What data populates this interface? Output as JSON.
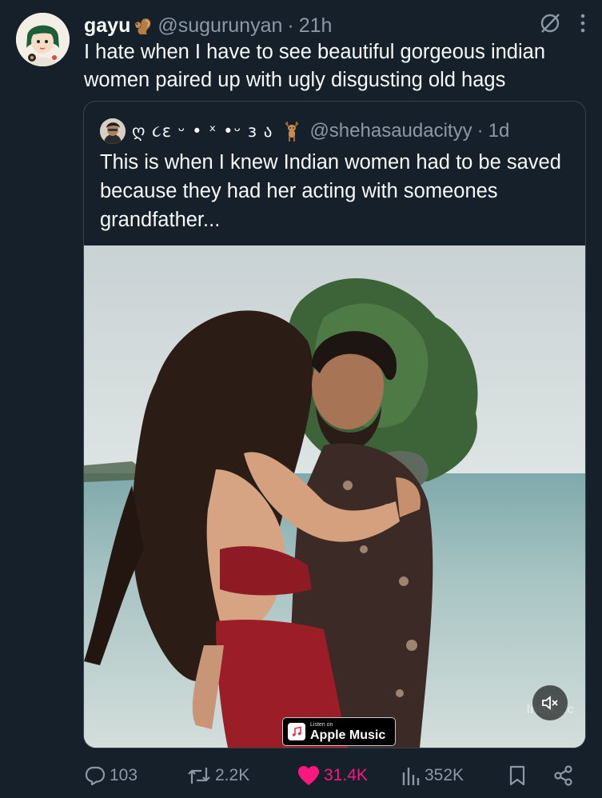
{
  "tweet": {
    "display_name": "gayu",
    "handle": "@sugurunyan",
    "separator": "·",
    "time": "21h",
    "text": "I hate when I have to see beautiful gorgeous indian women paired up with ugly disgusting old hags"
  },
  "quoted": {
    "display_name": "ღ ૮ɛ ᵕ • ˣ •ᵕ ɜ ა",
    "handle": "@shehasaudacityy",
    "separator": "·",
    "time": "1d",
    "text": "This is when I knew Indian women had to be saved because they had her acting with someones grandfather...",
    "media": {
      "badge_small": "Listen on",
      "badge_big": "Apple Music",
      "watermark": "InSh…c"
    }
  },
  "actions": {
    "replies": "103",
    "reposts": "2.2K",
    "likes": "31.4K",
    "views": "352K"
  },
  "colors": {
    "background": "#15202b",
    "text_secondary": "#8b98a5",
    "like_pink": "#f91880",
    "border": "#38444d"
  },
  "icons": [
    "grok-icon",
    "more-icon",
    "reply-icon",
    "repost-icon",
    "heart-icon",
    "views-icon",
    "bookmark-icon",
    "share-icon",
    "mute-icon",
    "apple-music-icon",
    "squirrel-emoji",
    "deer-emoji"
  ]
}
